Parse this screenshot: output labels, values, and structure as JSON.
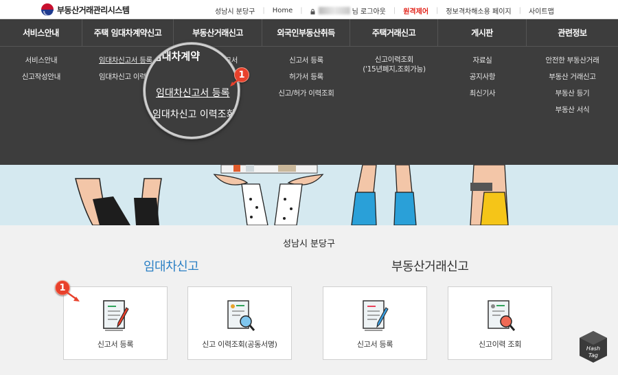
{
  "header": {
    "site_title": "부동산거래관리시스템",
    "region": "성남시 분당구",
    "home": "Home",
    "logout_suffix": "님 로그아웃",
    "remote_control": "원격제어",
    "privacy": "정보격차해소용 페이지",
    "sitemap": "사이트맵"
  },
  "nav": {
    "tabs": [
      "서비스안내",
      "주택 임대차계약신고",
      "부동산거래신고",
      "외국인부동산취득",
      "주택거래신고",
      "게시판",
      "관련정보"
    ],
    "menus": [
      [
        "서비스안내",
        "신고작성안내"
      ],
      [
        "임대차신고서 등록",
        "임대차신고 이력조회"
      ],
      [
        "신고서 등록"
      ],
      [
        "신고서 등록",
        "허가서 등록",
        "신고/허가 이력조회"
      ],
      [
        "신고이력조회",
        "('15년폐지,조회가능)"
      ],
      [
        "자료실",
        "공지사항",
        "최신기사"
      ],
      [
        "안전한 부동산거래",
        "부동산 거래신고",
        "부동산 등기",
        "부동산 서식"
      ]
    ]
  },
  "magnifier": {
    "title": "임대차계약",
    "item1": "임대차신고서 등록",
    "item2": "임대차신고 이력조회"
  },
  "badge": "1",
  "main": {
    "region": "성남시 분당구",
    "lease_title": "임대차신고",
    "realestate_title": "부동산거래신고",
    "cards": [
      "신고서 등록",
      "신고 이력조회(공동서명)",
      "신고서 등록",
      "신고이력 조회"
    ]
  },
  "watermark": {
    "line1": "Hash",
    "line2": "Tag"
  },
  "colors": {
    "nav_bg": "#3d3d3d",
    "lease_blue": "#2a7fc4",
    "accent_red": "#e2231a",
    "badge": "#e8412c",
    "hero_bg": "#d5e9f0"
  }
}
